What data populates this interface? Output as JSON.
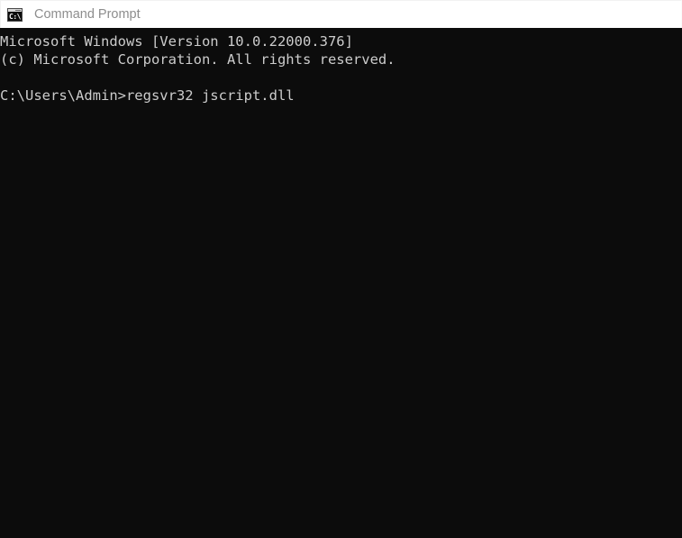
{
  "window": {
    "title": "Command Prompt",
    "icon": "command-prompt-icon",
    "icon_glyph": "C:\\",
    "titlebar_bg": "#ffffff",
    "title_color": "#8d8d8d"
  },
  "terminal": {
    "background": "#0c0c0c",
    "foreground": "#cccccc",
    "lines": [
      "Microsoft Windows [Version 10.0.22000.376]",
      "(c) Microsoft Corporation. All rights reserved.",
      "",
      "C:\\Users\\Admin>regsvr32 jscript.dll"
    ]
  }
}
